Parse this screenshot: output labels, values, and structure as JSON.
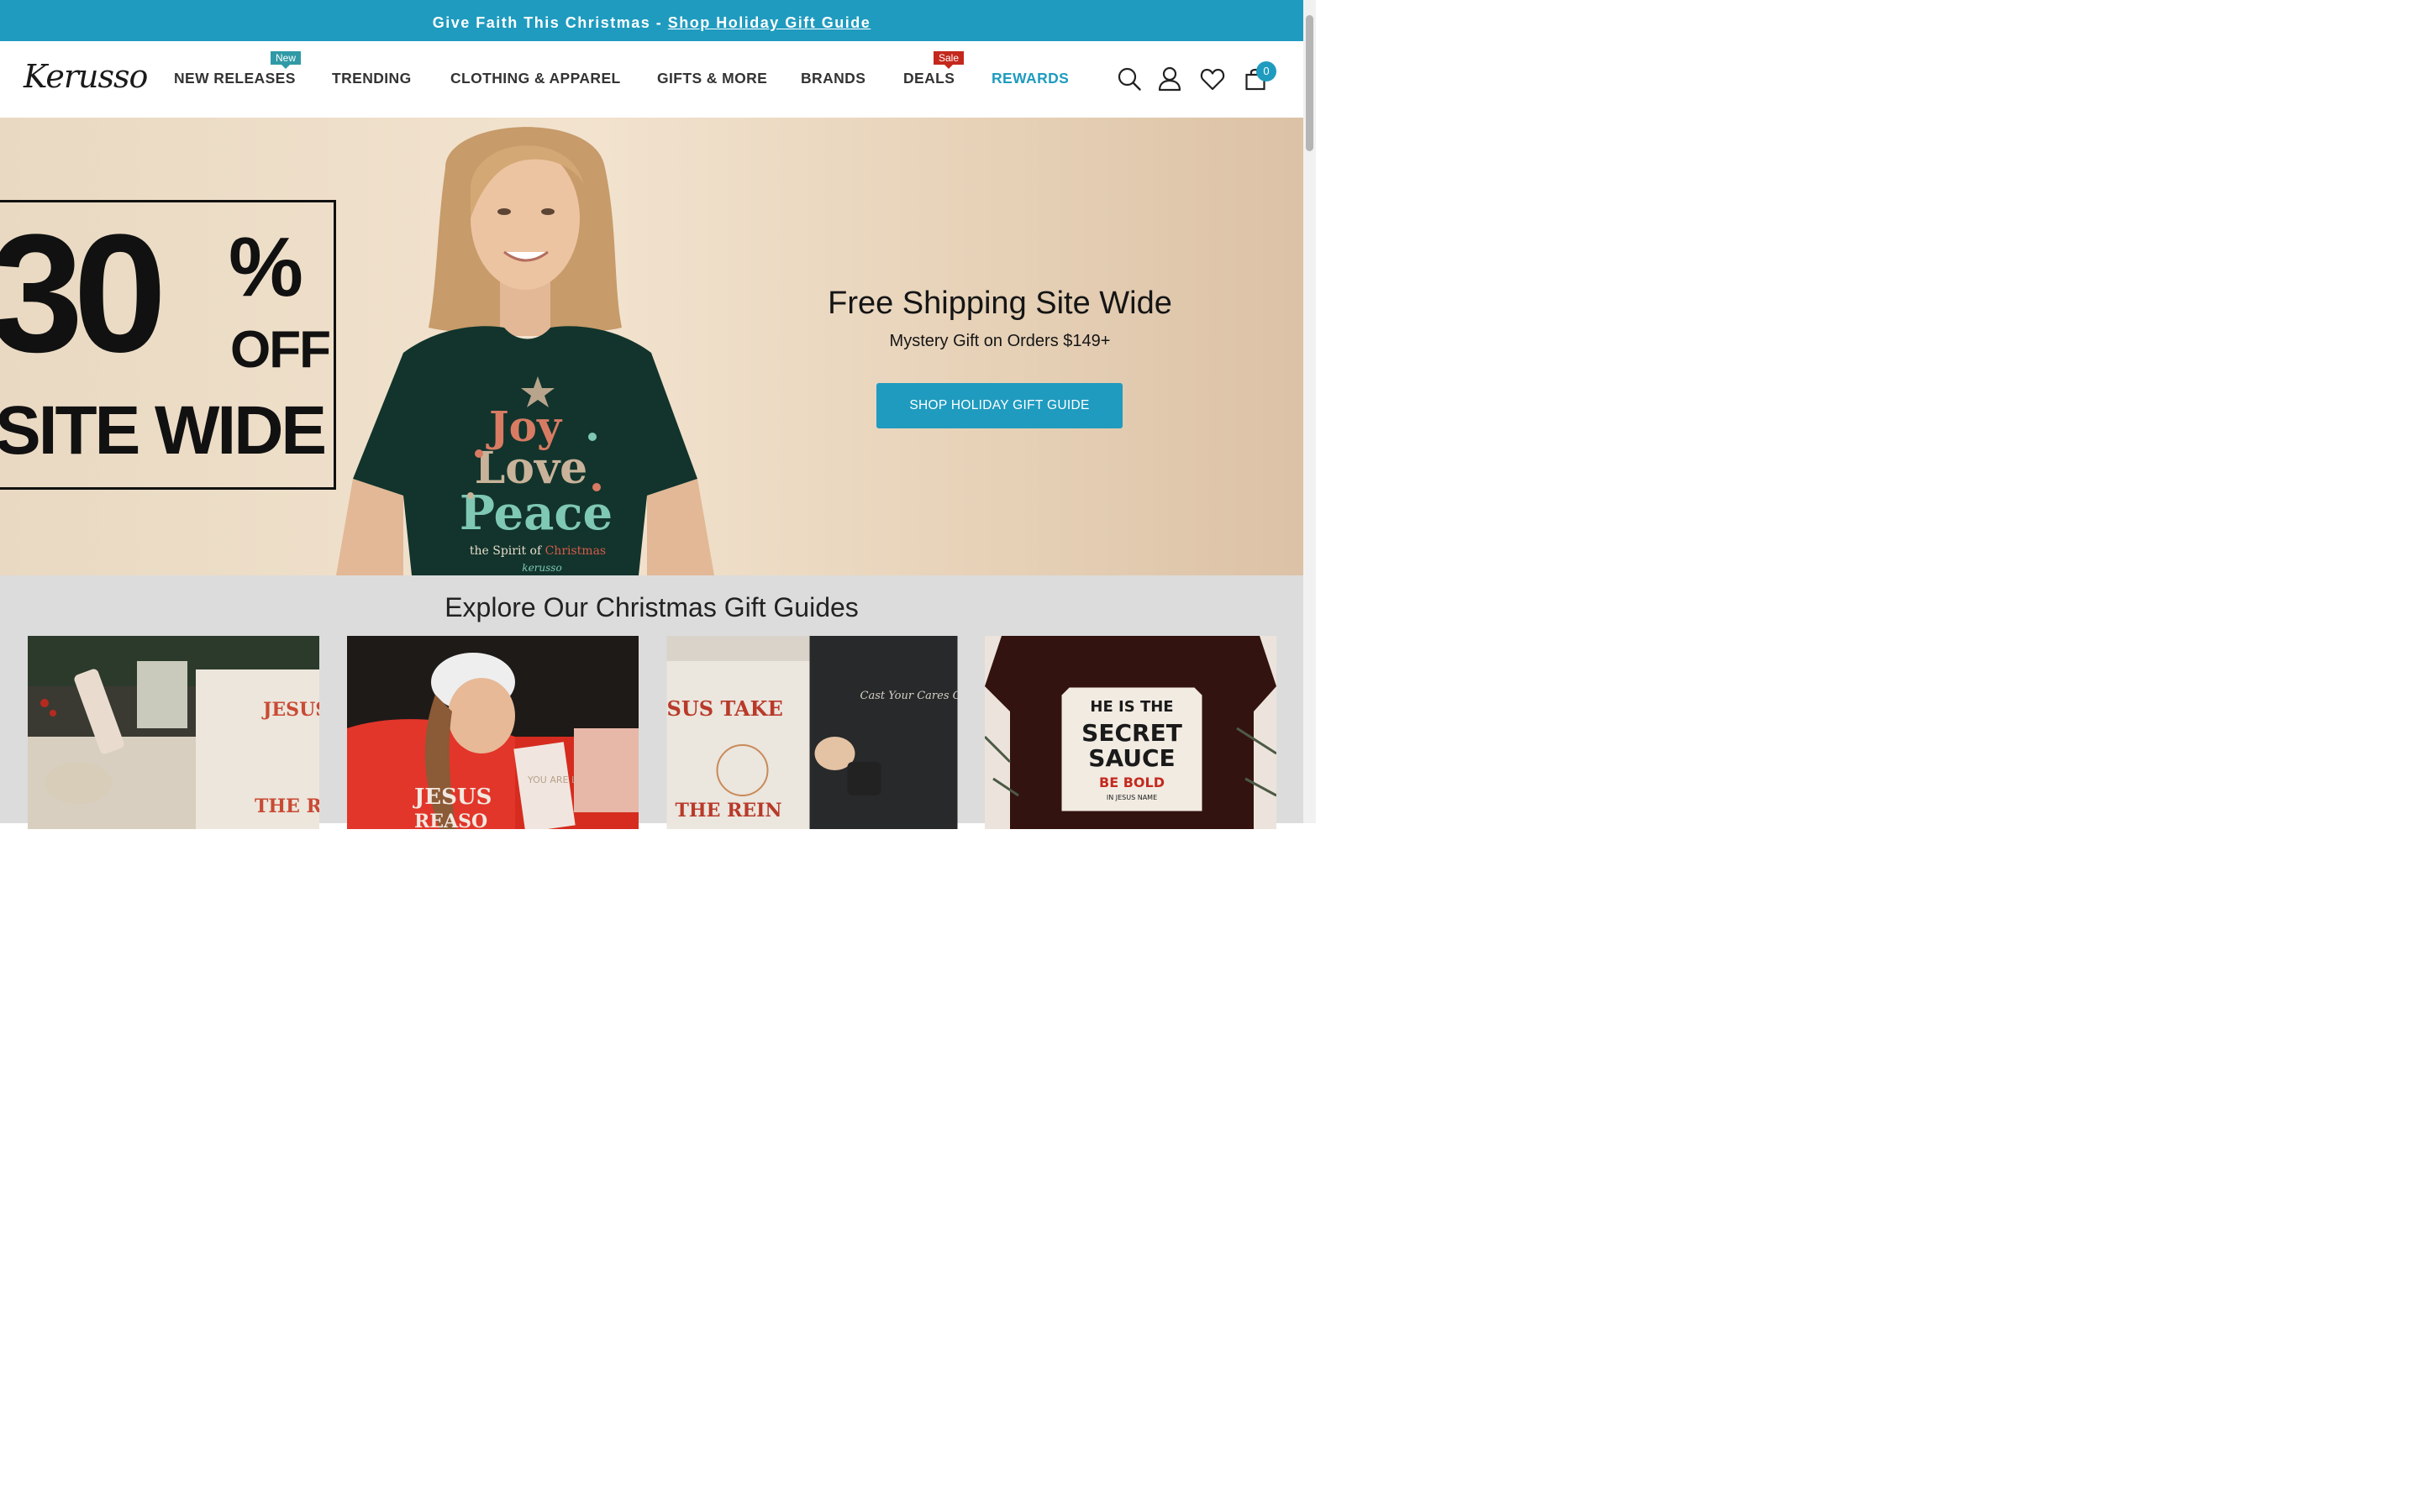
{
  "announcement": {
    "text": "Give Faith This Christmas - ",
    "link": "Shop Holiday Gift Guide"
  },
  "header": {
    "logo": "Kerusso",
    "nav": [
      {
        "label": "NEW RELEASES",
        "badge": "New"
      },
      {
        "label": "TRENDING"
      },
      {
        "label": "CLOTHING & APPAREL"
      },
      {
        "label": "GIFTS & MORE"
      },
      {
        "label": "BRANDS"
      },
      {
        "label": "DEALS",
        "badge": "Sale"
      },
      {
        "label": "REWARDS"
      }
    ],
    "icons": [
      "search-icon",
      "account-icon",
      "wishlist-heart-icon",
      "cart-bag-icon"
    ],
    "cart_count": "0"
  },
  "hero": {
    "promo_number": "30",
    "promo_percent": "%",
    "promo_off": "OFF",
    "promo_site": "SITE WIDE",
    "title": "Free Shipping Site Wide",
    "subtitle": "Mystery Gift on Orders $149+",
    "button": "SHOP HOLIDAY GIFT GUIDE",
    "shirt_text": {
      "line1": "Joy",
      "line2": "Love",
      "line3": "Peace",
      "tagline_prefix": "the Spirit of ",
      "tagline_highlight": "Christmas",
      "brand": "kerusso"
    }
  },
  "guides": {
    "title": "Explore Our Christmas Gift Guides",
    "cards": [
      {
        "text_a": "JESUS TA",
        "text_b": "THE RE"
      },
      {
        "text_a": "JESUS",
        "text_b": "REASO",
        "card_note": "YOU ARE LOVED"
      },
      {
        "text_a": "SUS TAKE",
        "text_b": "THE REIN",
        "shirt": "Cast Your Cares ON THE LORD"
      },
      {
        "text_a": "HE IS THE",
        "text_b": "SECRET",
        "text_c": "SAUCE",
        "text_d": "BE BOLD",
        "text_e": "IN JESUS NAME"
      }
    ]
  },
  "colors": {
    "accent": "#1f9bbf",
    "new_badge": "#2f9aa6",
    "sale_badge": "#c4281c",
    "hero_bg": "#efe0cb",
    "guides_bg": "#dcdcdc"
  }
}
